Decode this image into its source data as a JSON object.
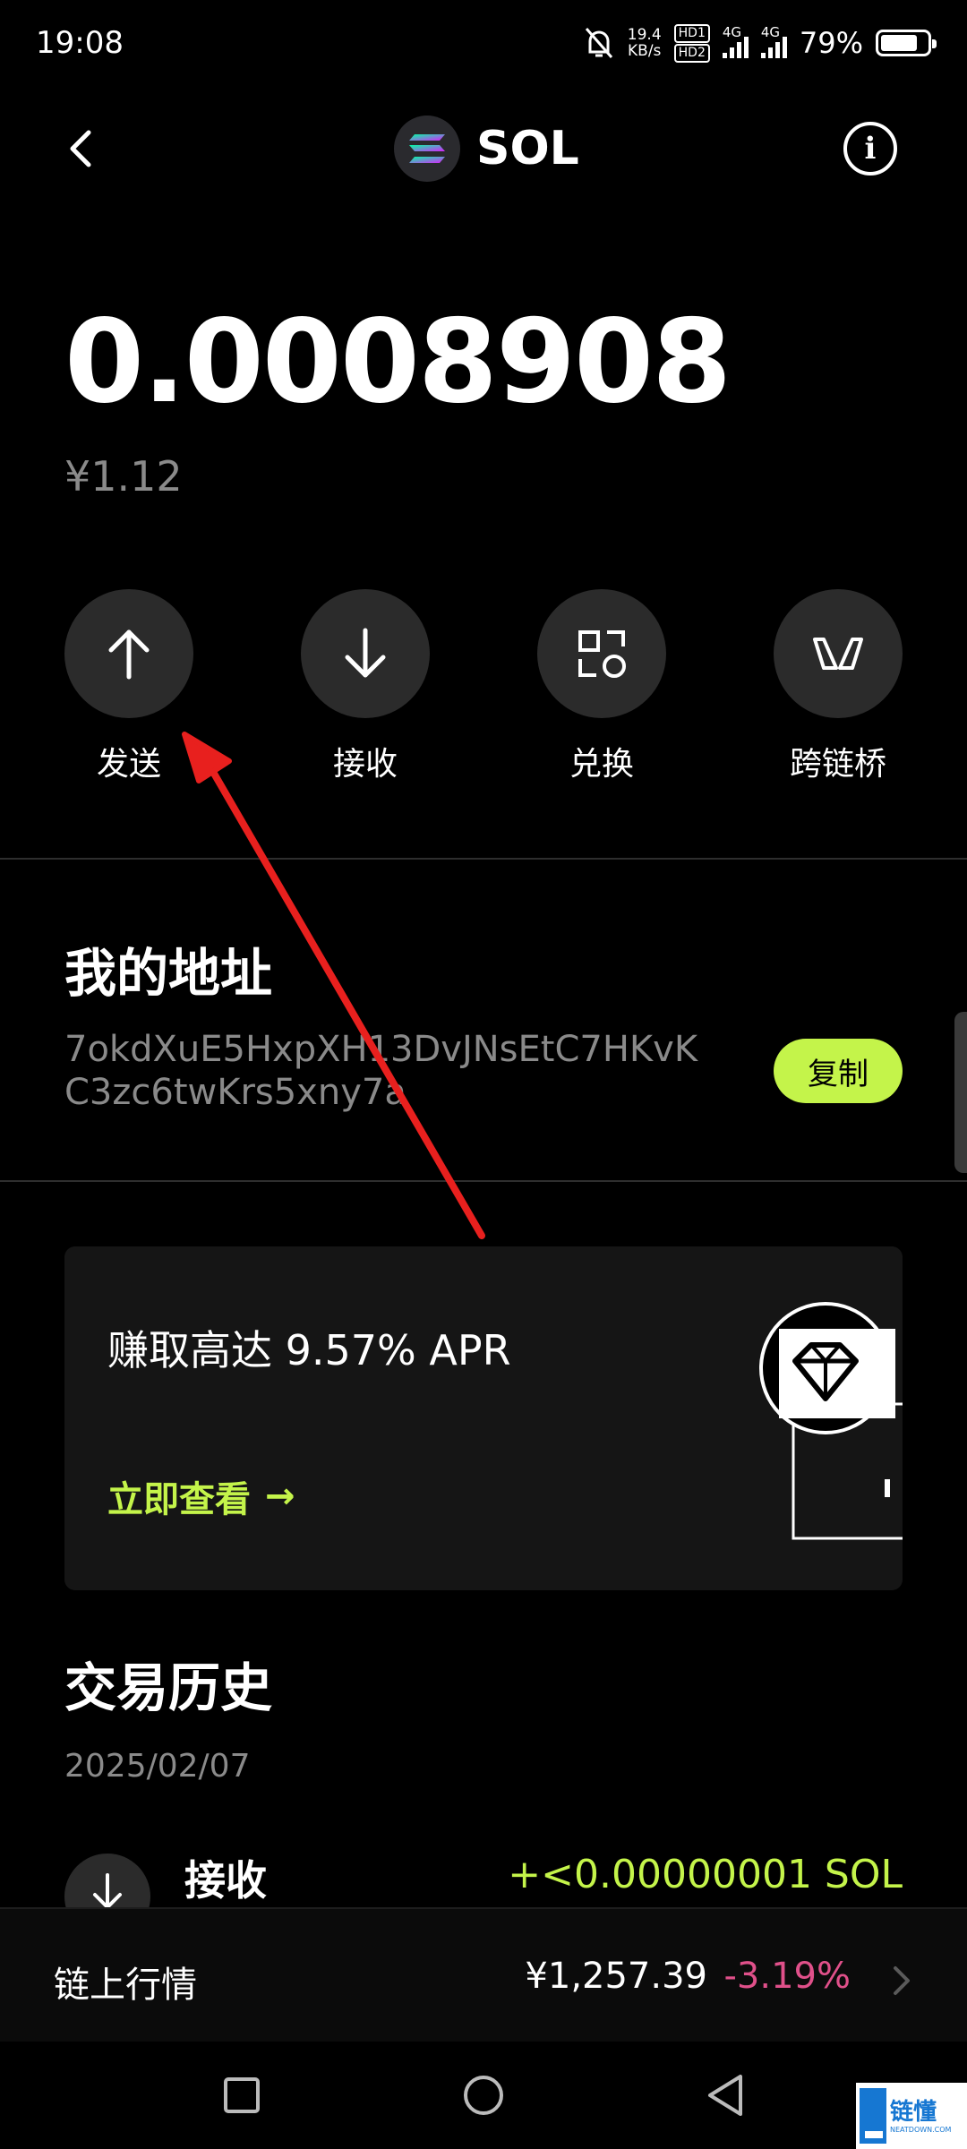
{
  "status_bar": {
    "time": "19:08",
    "net_speed_value": "19.4",
    "net_speed_unit": "KB/s",
    "hd_badge_1": "HD1",
    "hd_badge_2": "HD2",
    "signal_1_label": "4G",
    "signal_2_label": "4G",
    "battery_percent": "79%",
    "battery_level": 0.79
  },
  "header": {
    "token_name": "SOL",
    "back_icon": "chevron-left-icon",
    "info_icon": "info-icon",
    "info_glyph": "i"
  },
  "balance": {
    "amount": "0.0008908",
    "fiat_value": "¥1.12"
  },
  "actions": [
    {
      "label": "发送",
      "icon": "arrow-up-icon"
    },
    {
      "label": "接收",
      "icon": "arrow-down-icon"
    },
    {
      "label": "兑换",
      "icon": "swap-icon"
    },
    {
      "label": "跨链桥",
      "icon": "bridge-icon"
    }
  ],
  "address": {
    "title": "我的地址",
    "value": "7okdXuE5HxpXH13DvJNsEtC7HKvKC3zc6twKrs5xny7a",
    "copy_label": "复制"
  },
  "promo": {
    "title": "赚取高达 9.57% APR",
    "link_label": "立即查看",
    "link_arrow": "→"
  },
  "history": {
    "title": "交易历史",
    "date": "2025/02/07",
    "transactions": [
      {
        "type": "接收",
        "amount": "+<0.00000001 SOL"
      }
    ]
  },
  "market": {
    "label": "链上行情",
    "price": "¥1,257.39",
    "change": "-3.19%"
  },
  "colors": {
    "accent": "#c4f44a",
    "negative": "#e0508a",
    "muted": "#8a8a8a",
    "button_bg": "#2b2b2b",
    "annotation": "#e8201e"
  },
  "watermark": {
    "text": "链懂",
    "subtext": "NEATDOWN.COM"
  }
}
